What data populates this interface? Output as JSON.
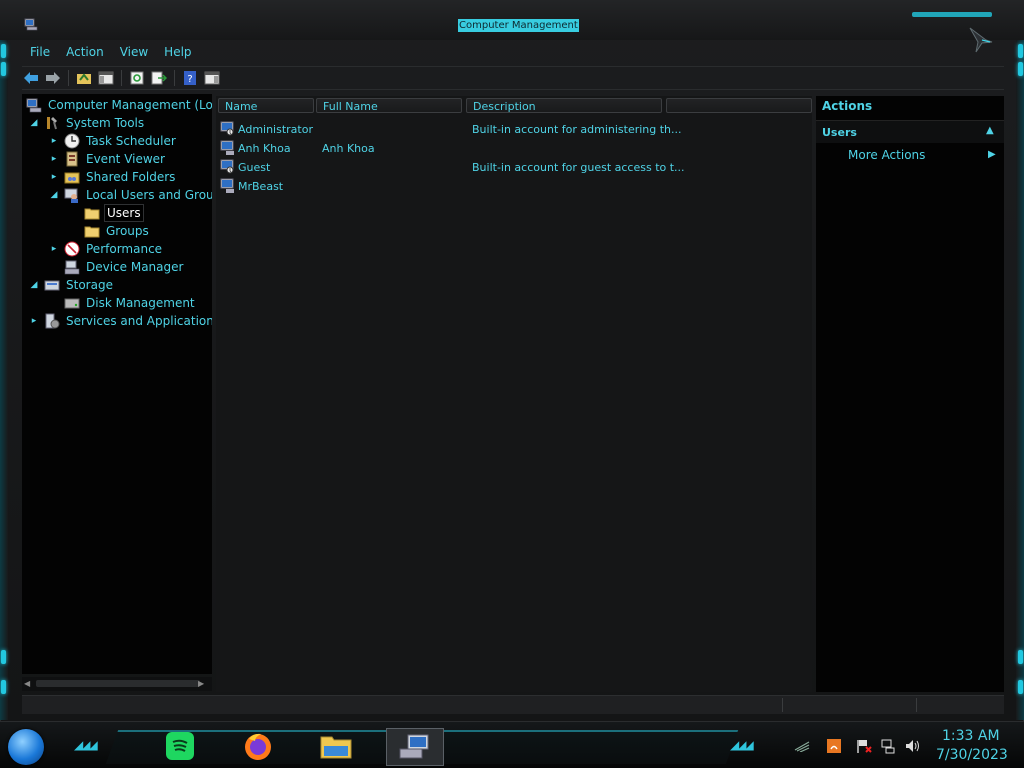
{
  "window": {
    "title": "Computer Management"
  },
  "menu": [
    "File",
    "Action",
    "View",
    "Help"
  ],
  "tree": {
    "root": "Computer Management (Local)",
    "system_tools": "System Tools",
    "task_scheduler": "Task Scheduler",
    "event_viewer": "Event Viewer",
    "shared_folders": "Shared Folders",
    "local_users_groups": "Local Users and Groups",
    "users": "Users",
    "groups": "Groups",
    "performance": "Performance",
    "device_manager": "Device Manager",
    "storage": "Storage",
    "disk_management": "Disk Management",
    "services_apps": "Services and Applications"
  },
  "list": {
    "columns": [
      "Name",
      "Full Name",
      "Description"
    ],
    "rows": [
      {
        "name": "Administrator",
        "full_name": "",
        "description": "Built-in account for administering th..."
      },
      {
        "name": "Anh Khoa",
        "full_name": "Anh Khoa",
        "description": ""
      },
      {
        "name": "Guest",
        "full_name": "",
        "description": "Built-in account for guest access to t..."
      },
      {
        "name": "MrBeast",
        "full_name": "",
        "description": ""
      }
    ]
  },
  "actions": {
    "title": "Actions",
    "section": "Users",
    "more": "More Actions"
  },
  "taskbar": {
    "time": "1:33 AM",
    "date": "7/30/2023",
    "apps": [
      "spotify-icon",
      "firefox-icon",
      "file-explorer-icon",
      "computer-management-icon"
    ]
  },
  "colors": {
    "accent": "#4fd3e6",
    "background": "#151617",
    "panel": "#030303"
  }
}
